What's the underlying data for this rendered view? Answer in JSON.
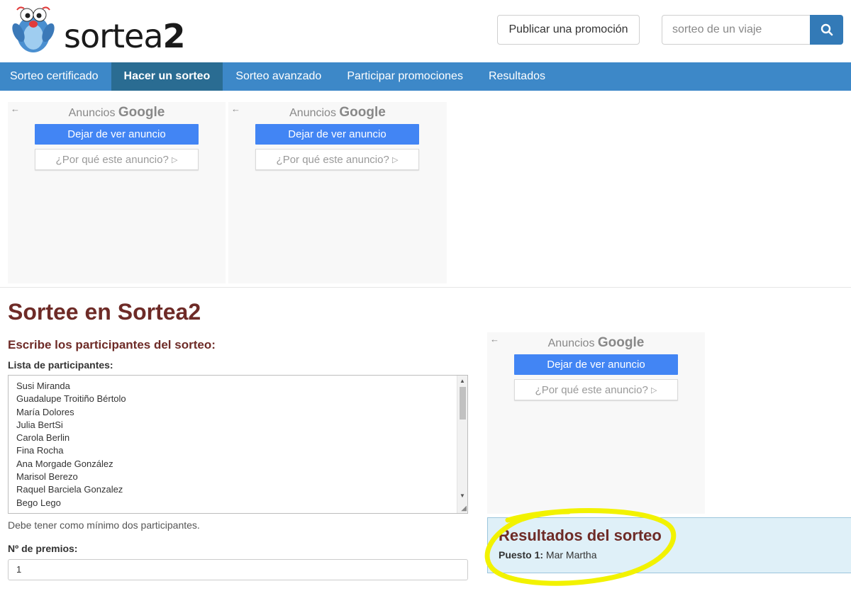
{
  "header": {
    "logo_text_main": "sortea",
    "logo_text_digit": "2",
    "publish_button_label": "Publicar una promoción",
    "search_placeholder": "sorteo de un viaje"
  },
  "nav": {
    "items": [
      {
        "label": "Sorteo certificado"
      },
      {
        "label": "Hacer un sorteo"
      },
      {
        "label": "Sorteo avanzado"
      },
      {
        "label": "Participar promociones"
      },
      {
        "label": "Resultados"
      }
    ],
    "active_index": 1
  },
  "ads": {
    "title_prefix": "Anuncios",
    "title_brand": "Google",
    "stop_button": "Dejar de ver anuncio",
    "why_button": "¿Por qué este anuncio?"
  },
  "main": {
    "page_title": "Sortee en Sortea2",
    "subtitle": "Escribe los participantes del sorteo:",
    "list_label": "Lista de participantes:",
    "participants": [
      "Susi Miranda",
      "Guadalupe Troitiño Bértolo",
      "María Dolores",
      "Julia BertSi",
      "Carola Berlin",
      "Fina Rocha",
      "Ana Morgade González",
      "Marisol Berezo",
      "Raquel Barciela Gonzalez",
      "Bego Lego"
    ],
    "hint": "Debe tener como mínimo dos participantes.",
    "prizes_label": "Nº de premios:",
    "prizes_value": "1"
  },
  "results": {
    "title": "Resultados del sorteo",
    "position_label": "Puesto 1:",
    "position_value": "Mar Martha"
  },
  "colors": {
    "nav_bg": "#3d88c8",
    "nav_active": "#2a6c92",
    "title_color": "#6e2b27",
    "search_button": "#337ab7",
    "ad_button": "#4285f4",
    "results_bg": "#dff0f8",
    "highlight": "#f2f200"
  }
}
